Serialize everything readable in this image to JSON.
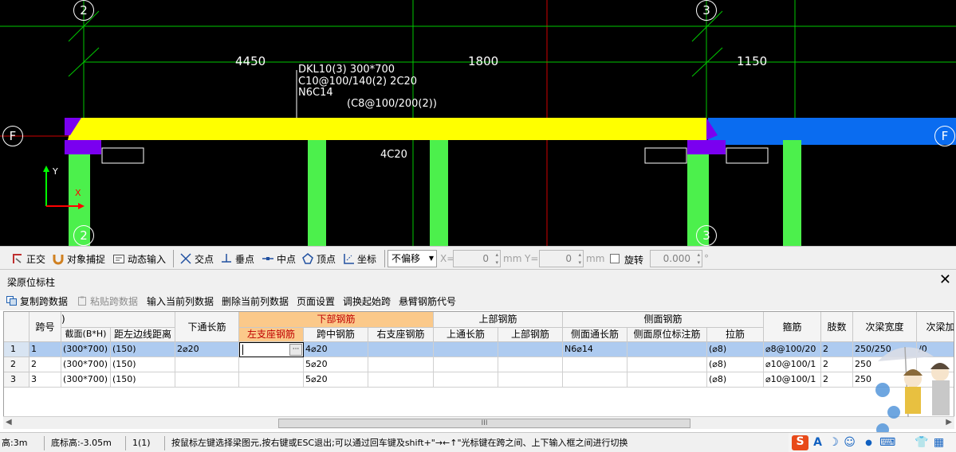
{
  "cad": {
    "axis_labels": {
      "top_2": "2",
      "top_3": "3",
      "left_f": "F",
      "right_f": "F",
      "bottom_2": "2",
      "bottom_3": "3"
    },
    "dimensions": {
      "d1": "4450",
      "d2": "1800",
      "d3": "1150"
    },
    "beam_annotation": {
      "line1": "DKL10(3) 300*700",
      "line2": "C10@100/140(2) 2C20",
      "line3": "N6C14",
      "line4": "(C8@100/200(2))"
    },
    "mid_label": "4C20",
    "ucs": {
      "y": "Y",
      "x": "X"
    },
    "colors": {
      "beam": "#ffff00",
      "beam_blue": "#0a6cf0",
      "column": "#4cf04c",
      "support": "#7a00f0",
      "grid_line": "#00c800",
      "axis_red": "#d00000"
    }
  },
  "snapbar": {
    "ortho": "正交",
    "object_snap": "对象捕捉",
    "dynamic_input": "动态输入",
    "intersection": "交点",
    "perpendicular": "垂点",
    "midpoint": "中点",
    "vertex": "顶点",
    "coordinate": "坐标",
    "offset_mode": "不偏移",
    "x_label": "X=",
    "x_value": "0",
    "x_unit": "mm",
    "y_label": "Y=",
    "y_value": "0",
    "y_unit": "mm",
    "rotate_label": "旋转",
    "rotate_value": "0.000",
    "rotate_unit": "°"
  },
  "panel": {
    "title": "梁原位标柱",
    "close": "✕",
    "tools": {
      "copy_span": "复制跨数据",
      "paste_span": "粘贴跨数据",
      "input_column": "输入当前列数据",
      "delete_column": "删除当前列数据",
      "page_setup": "页面设置",
      "adjust_start": "调换起始跨",
      "cantilever_code": "悬臂钢筋代号"
    },
    "grid": {
      "group_headers": {
        "top_left": ")",
        "bottom_rebar": "下部钢筋",
        "top_rebar": "上部钢筋",
        "side_rebar": "侧面钢筋"
      },
      "headers": {
        "span_no": "跨号",
        "section": "截面(B*H)",
        "dist_left": "距左边线距离",
        "bottom_through": "下通长筋",
        "left_support": "左支座钢筋",
        "mid_span": "跨中钢筋",
        "right_support": "右支座钢筋",
        "top_through": "上通长筋",
        "top_rebar": "上部钢筋",
        "side_through": "侧面通长筋",
        "side_original": "侧面原位标注筋",
        "tie": "拉筋",
        "stirrup": "箍筋",
        "legs": "肢数",
        "sub_beam_width": "次梁宽度",
        "sub_beam_more": "次梁加"
      },
      "rows": [
        {
          "idx": "1",
          "span": "1",
          "section": "(300*700)",
          "dist": "(150)",
          "bottom_through": "2⌀20",
          "left_support": "",
          "cell_btn": "···",
          "mid_span": "4⌀20",
          "right_support": "",
          "top_through": "",
          "top_rebar": "",
          "side_through": "N6⌀14",
          "side_original": "",
          "tie": "(⌀8)",
          "stirrup": "⌀8@100/20",
          "legs": "2",
          "sub_width": "250/250",
          "sub_more": "/0"
        },
        {
          "idx": "2",
          "span": "2",
          "section": "(300*700)",
          "dist": "(150)",
          "bottom_through": "",
          "left_support": "",
          "cell_btn": "",
          "mid_span": "5⌀20",
          "right_support": "",
          "top_through": "",
          "top_rebar": "",
          "side_through": "",
          "side_original": "",
          "tie": "(⌀8)",
          "stirrup": "⌀10@100/1",
          "legs": "2",
          "sub_width": "250",
          "sub_more": ""
        },
        {
          "idx": "3",
          "span": "3",
          "section": "(300*700)",
          "dist": "(150)",
          "bottom_through": "",
          "left_support": "",
          "cell_btn": "",
          "mid_span": "5⌀20",
          "right_support": "",
          "top_through": "",
          "top_rebar": "",
          "side_through": "",
          "side_original": "",
          "tie": "(⌀8)",
          "stirrup": "⌀10@100/1",
          "legs": "2",
          "sub_width": "250",
          "sub_more": ""
        }
      ]
    },
    "scroll_thumb": "III"
  },
  "status": {
    "height": "高:3m",
    "bottom_elev": "底标高:-3.05m",
    "count": "1(1)",
    "hint": "按鼠标左键选择梁图元,按右键或ESC退出;可以通过回车键及shift+\"→←↑\"光标键在跨之间、上下输入框之间进行切换"
  },
  "tray": {
    "s_logo": "S",
    "lang": "A",
    "moon": "☽",
    "smile": "☺",
    "mic": "●",
    "keyboard": "⌨",
    "shirt": "👕",
    "grid": "▦"
  }
}
